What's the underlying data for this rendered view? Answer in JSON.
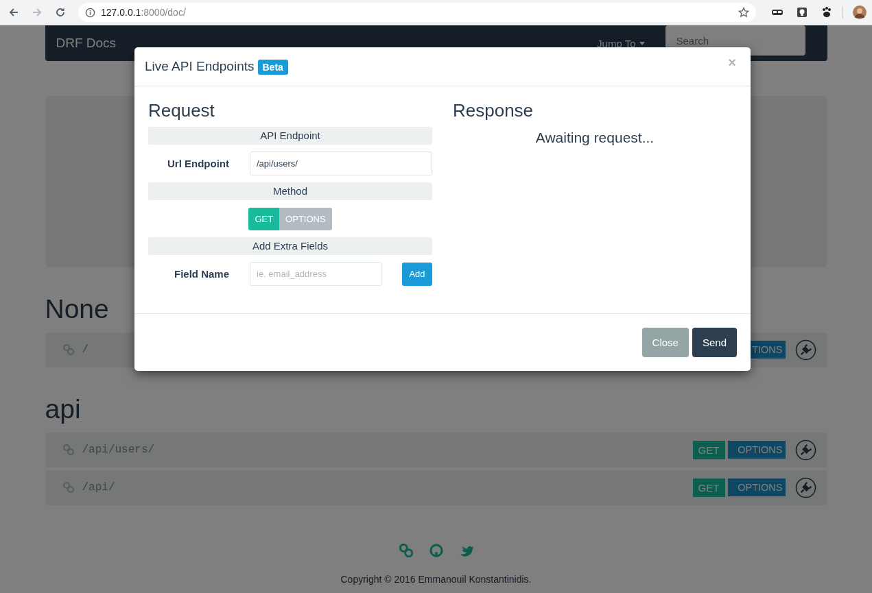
{
  "browser": {
    "host": "127.0.0.1",
    "path": ":8000/doc/"
  },
  "navbar": {
    "brand": "DRF Docs",
    "jump_to": "Jump To",
    "search_placeholder": "Search"
  },
  "groups": [
    {
      "title": "None",
      "endpoints": [
        {
          "path": "/",
          "methods": [
            {
              "label": "TIONS",
              "kind": "options"
            }
          ]
        }
      ]
    },
    {
      "title": "api",
      "endpoints": [
        {
          "path": "/api/users/",
          "methods": [
            {
              "label": "GET",
              "kind": "get"
            },
            {
              "label": "OPTIONS",
              "kind": "options"
            }
          ]
        },
        {
          "path": "/api/",
          "methods": [
            {
              "label": "GET",
              "kind": "get"
            },
            {
              "label": "OPTIONS",
              "kind": "options"
            }
          ]
        }
      ]
    }
  ],
  "footer": {
    "copyright": "Copyright © 2016 Emmanouil Konstantinidis."
  },
  "modal": {
    "title": "Live API Endpoints",
    "badge": "Beta",
    "close": "×",
    "request": {
      "heading": "Request",
      "endpoint_section": "API Endpoint",
      "url_label": "Url Endpoint",
      "url_value": "/api/users/",
      "method_section": "Method",
      "methods": [
        {
          "label": "GET",
          "selected": true
        },
        {
          "label": "OPTIONS",
          "selected": false
        }
      ],
      "extra_section": "Add Extra Fields",
      "field_label": "Field Name",
      "field_placeholder": "ie. email_address",
      "add_button": "Add"
    },
    "response": {
      "heading": "Response",
      "status": "Awaiting request..."
    },
    "buttons": [
      {
        "label": "Close",
        "kind": "secondary"
      },
      {
        "label": "Send",
        "kind": "primary"
      }
    ]
  }
}
